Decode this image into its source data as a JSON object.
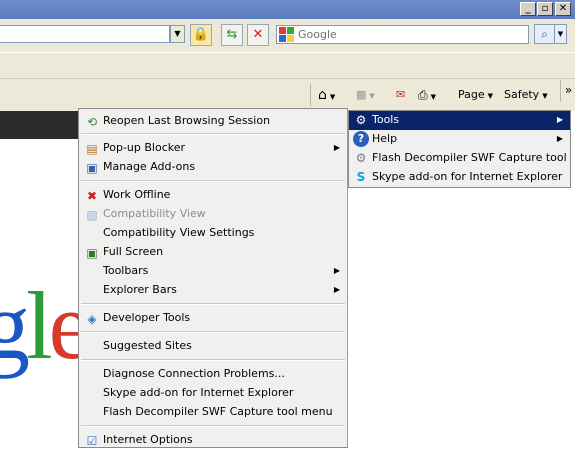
{
  "search": {
    "placeholder": "Google"
  },
  "commandbar": {
    "page_label": "Page",
    "safety_label": "Safety",
    "overflow_label": "»"
  },
  "logo_text": {
    "a": "g",
    "b": "l",
    "c": "e"
  },
  "menu": {
    "items": [
      {
        "label": "Reopen Last Browsing Session",
        "icon": "reopen-session-icon"
      },
      {
        "label": "Pop-up Blocker",
        "icon": "popup-blocker-icon",
        "submenu": true
      },
      {
        "label": "Manage Add-ons",
        "icon": "manage-addons-icon"
      },
      {
        "label": "Work Offline",
        "icon": "work-offline-icon"
      },
      {
        "label": "Compatibility View",
        "icon": "compatibility-view-icon",
        "disabled": true
      },
      {
        "label": "Compatibility View Settings"
      },
      {
        "label": "Full Screen",
        "icon": "full-screen-icon"
      },
      {
        "label": "Toolbars",
        "submenu": true
      },
      {
        "label": "Explorer Bars",
        "submenu": true
      },
      {
        "label": "Developer Tools",
        "icon": "developer-tools-icon"
      },
      {
        "label": "Suggested Sites"
      },
      {
        "label": "Diagnose Connection Problems..."
      },
      {
        "label": "Skype add-on for Internet Explorer"
      },
      {
        "label": "Flash Decompiler SWF Capture tool menu"
      },
      {
        "label": "Internet Options",
        "icon": "internet-options-icon"
      }
    ]
  },
  "submenu": {
    "items": [
      {
        "label": "Tools",
        "icon": "gear-icon",
        "submenu": true,
        "highlighted": true
      },
      {
        "label": "Help",
        "icon": "help-icon",
        "submenu": true
      },
      {
        "label": "Flash Decompiler SWF Capture tool",
        "icon": "flash-decompiler-icon"
      },
      {
        "label": "Skype add-on for Internet Explorer",
        "icon": "skype-icon"
      }
    ]
  },
  "colors": {
    "highlight": "#0a246a",
    "menu_bg": "#f0f0ee",
    "toolbar_bg": "#ece9d8"
  }
}
